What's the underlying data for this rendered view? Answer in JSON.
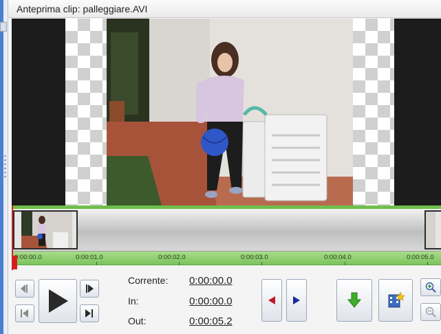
{
  "window": {
    "title": "Anteprima clip: palleggiare.AVI"
  },
  "timeline": {
    "ticks": [
      "0:00:00.0",
      "0:00:01.0",
      "0:00:02.0",
      "0:00:03.0",
      "0:00:04.0",
      "0:00:05.0"
    ]
  },
  "controls": {
    "current_label": "Corrente:",
    "current_value": "0:00:00.0",
    "in_label": "In:",
    "in_value": "0:00:00.0",
    "out_label": "Out:",
    "out_value": "0:00:05.2"
  },
  "colors": {
    "timeline_green": "#7cc35d",
    "playhead_red": "#d52020",
    "mark_in_red": "#c0182c",
    "mark_out_blue": "#1e2ba0",
    "insert_green": "#3fae2a"
  },
  "icons": [
    "prev-frame-icon",
    "play-icon",
    "next-frame-icon",
    "go-start-icon",
    "go-end-icon",
    "mark-in-icon",
    "mark-out-icon",
    "insert-clip-icon",
    "clip-properties-icon",
    "zoom-in-icon",
    "zoom-out-icon"
  ]
}
